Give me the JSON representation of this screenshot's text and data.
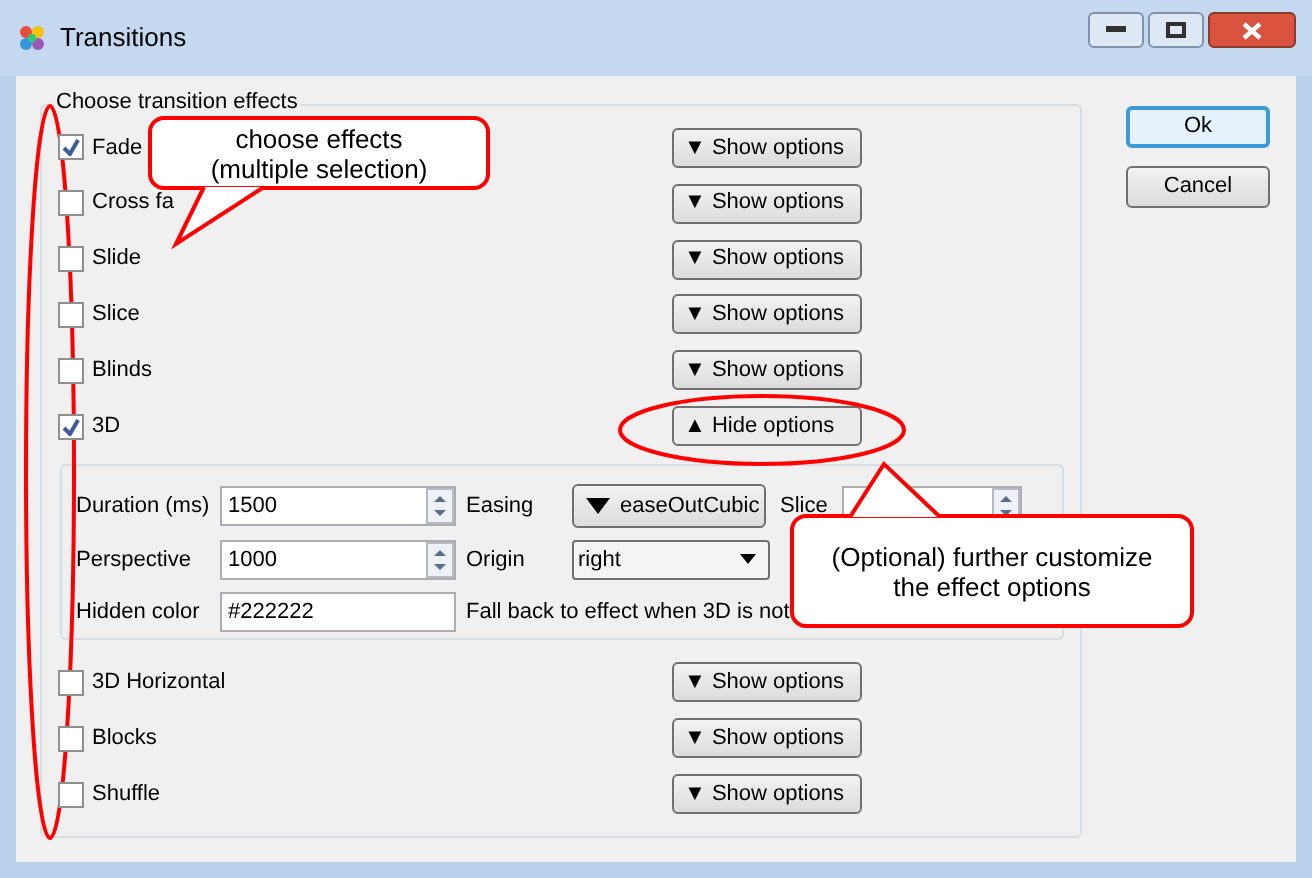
{
  "window": {
    "title": "Transitions"
  },
  "group_title": "Choose transition effects",
  "effects": [
    {
      "label": "Fade",
      "checked": true,
      "button": "▼ Show options",
      "expanded": false
    },
    {
      "label": "Cross fa",
      "checked": false,
      "button": "▼ Show options",
      "expanded": false
    },
    {
      "label": "Slide",
      "checked": false,
      "button": "▼ Show options",
      "expanded": false
    },
    {
      "label": "Slice",
      "checked": false,
      "button": "▼ Show options",
      "expanded": false
    },
    {
      "label": "Blinds",
      "checked": false,
      "button": "▼ Show options",
      "expanded": false
    },
    {
      "label": "3D",
      "checked": true,
      "button": "▲ Hide options",
      "expanded": true,
      "options": {
        "duration": {
          "label": "Duration (ms)",
          "value": "1500"
        },
        "easing": {
          "label": "Easing",
          "value": "easeOutCubic"
        },
        "slice": {
          "label": "Slice"
        },
        "perspective": {
          "label": "Perspective",
          "value": "1000"
        },
        "origin": {
          "label": "Origin",
          "value": "right"
        },
        "hidden_color": {
          "label": "Hidden color",
          "value": "#222222"
        },
        "fallback": {
          "label": "Fall back to effect when 3D is not"
        }
      }
    },
    {
      "label": "3D Horizontal",
      "checked": false,
      "button": "▼ Show options",
      "expanded": false
    },
    {
      "label": "Blocks",
      "checked": false,
      "button": "▼ Show options",
      "expanded": false
    },
    {
      "label": "Shuffle",
      "checked": false,
      "button": "▼ Show options",
      "expanded": false
    }
  ],
  "buttons": [
    {
      "label": "Ok",
      "default": true
    },
    {
      "label": "Cancel",
      "default": false
    }
  ],
  "callouts": [
    {
      "lines": [
        "choose effects",
        "(multiple selection)"
      ]
    },
    {
      "lines": [
        "(Optional) further customize",
        "the effect options"
      ]
    }
  ]
}
